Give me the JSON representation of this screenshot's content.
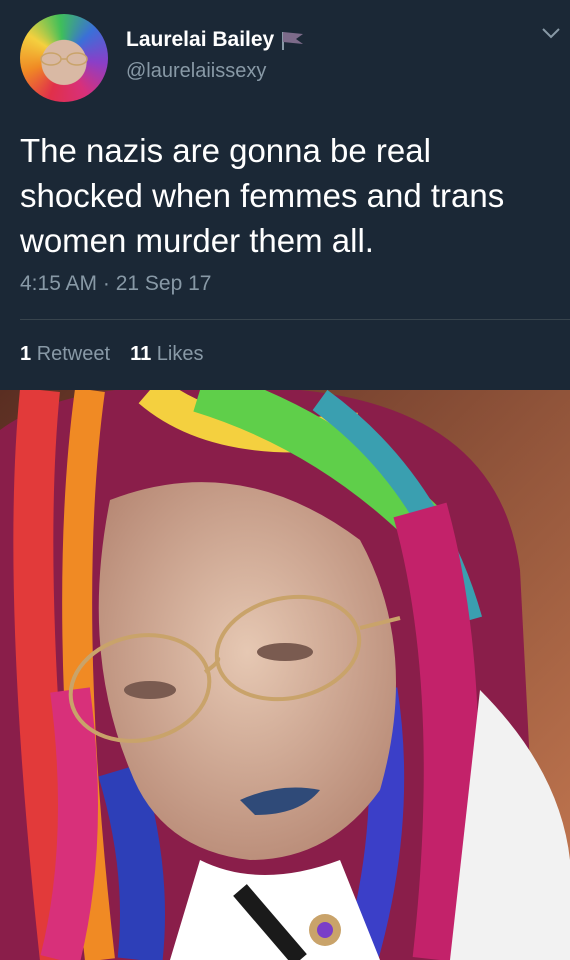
{
  "tweet": {
    "display_name": "Laurelai Bailey",
    "handle": "@laurelaiissexy",
    "text": "The nazis are gonna be real shocked when femmes and trans women murder them all.",
    "timestamp": "4:15 AM · 21 Sep 17",
    "retweets_count": "1",
    "retweets_label": "Retweet",
    "likes_count": "11",
    "likes_label": "Likes"
  },
  "icons": {
    "flag": "flag-icon",
    "chevron": "chevron-down-icon"
  },
  "colors": {
    "background": "#1b2836",
    "secondary_text": "#8899a6",
    "divider": "#38444d"
  }
}
